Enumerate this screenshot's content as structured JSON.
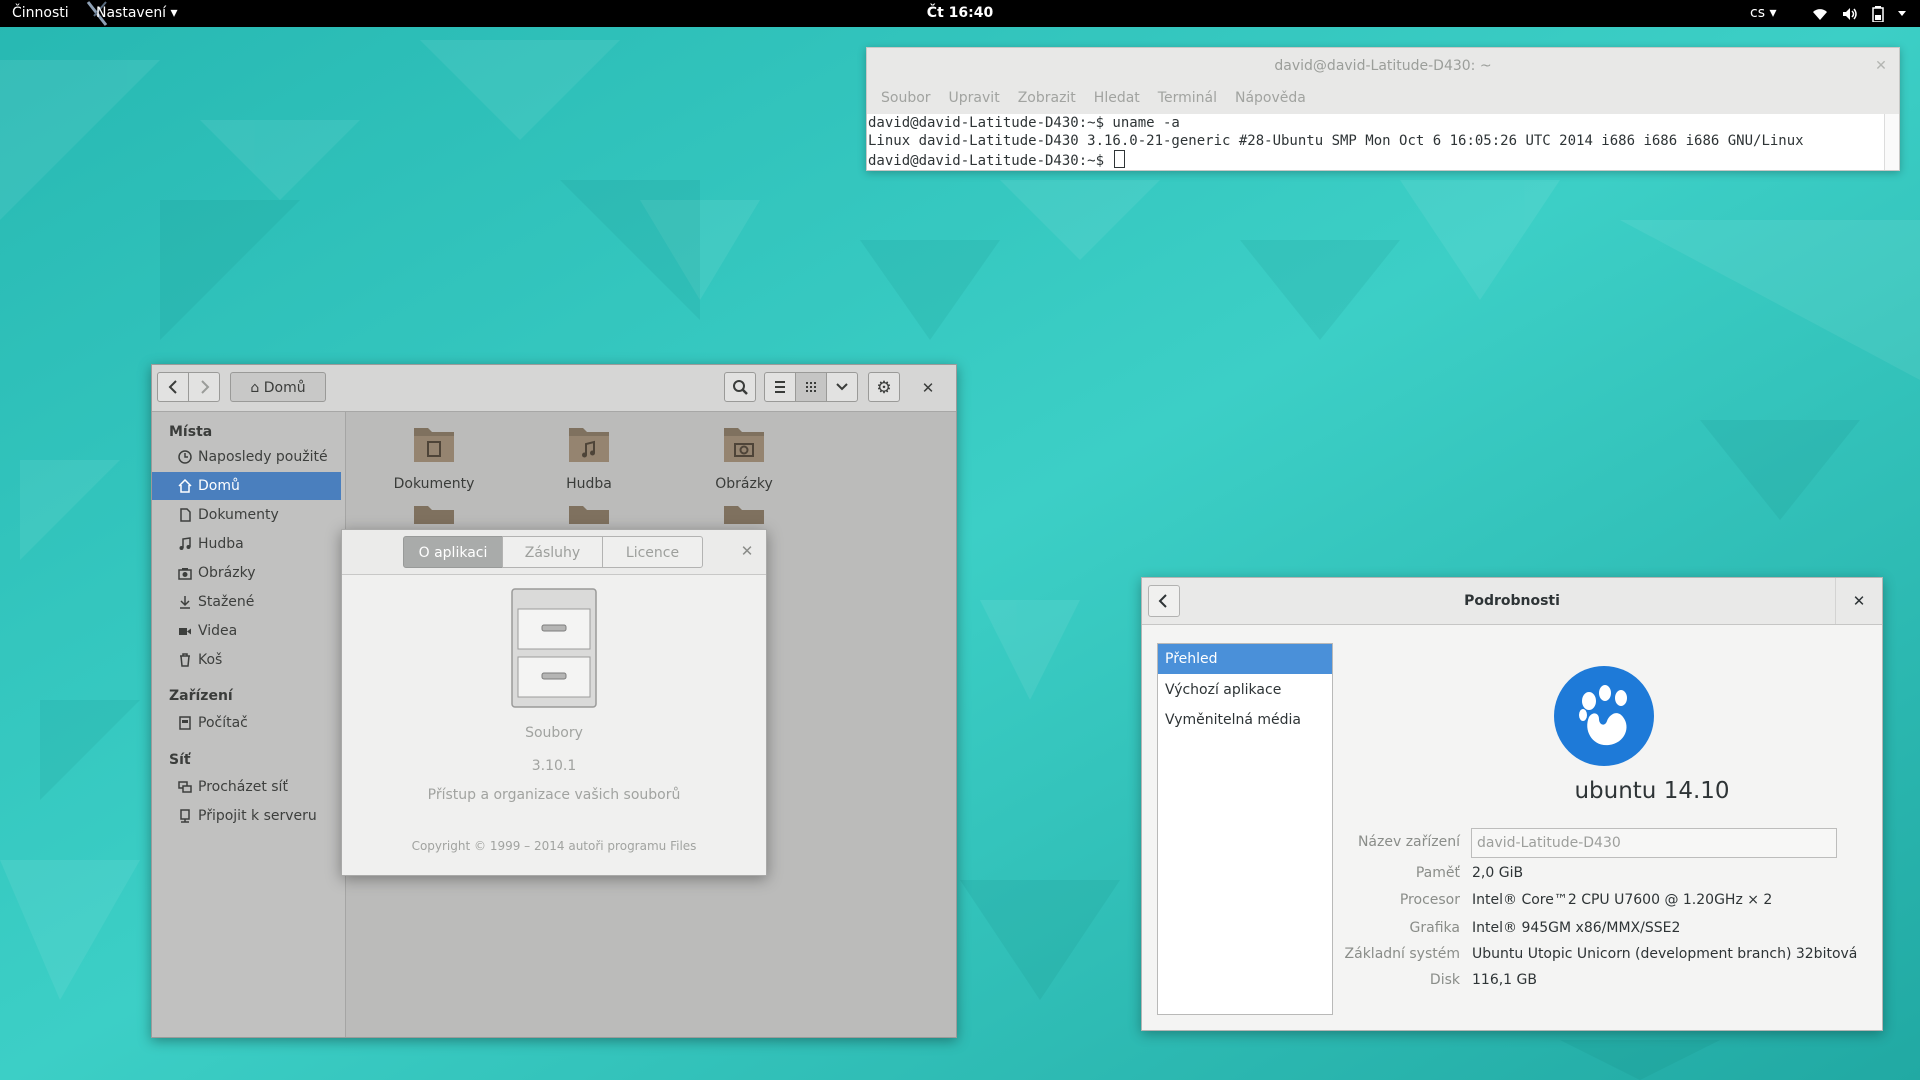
{
  "topbar": {
    "activities": "Činnosti",
    "app_menu": "Nastavení ▾",
    "clock": "Čt 16:40",
    "lang": "cs ▾"
  },
  "terminal": {
    "title": "david@david-Latitude-D430: ~",
    "menu": [
      "Soubor",
      "Upravit",
      "Zobrazit",
      "Hledat",
      "Terminál",
      "Nápověda"
    ],
    "lines": [
      "david@david-Latitude-D430:~$ uname -a",
      "Linux david-Latitude-D430 3.16.0-21-generic #28-Ubuntu SMP Mon Oct 6 16:05:26 UTC 2014 i686 i686 i686 GNU/Linux",
      "david@david-Latitude-D430:~$ "
    ]
  },
  "files": {
    "location": "Domů",
    "sidebar": {
      "places_heading": "Místa",
      "places": [
        "Naposledy použité",
        "Domů",
        "Dokumenty",
        "Hudba",
        "Obrázky",
        "Stažené",
        "Videa",
        "Koš"
      ],
      "devices_heading": "Zařízení",
      "devices": [
        "Počítač"
      ],
      "network_heading": "Síť",
      "network": [
        "Procházet síť",
        "Připojit k serveru"
      ]
    },
    "folders": [
      "Dokumenty",
      "Hudba",
      "Obrázky"
    ]
  },
  "about": {
    "tabs": [
      "O aplikaci",
      "Zásluhy",
      "Licence"
    ],
    "app_name": "Soubory",
    "version": "3.10.1",
    "description": "Přístup a organizace vašich souborů",
    "copyright": "Copyright © 1999 – 2014 autoři programu Files"
  },
  "details": {
    "title": "Podrobnosti",
    "nav": [
      "Přehled",
      "Výchozí aplikace",
      "Vyměnitelná média"
    ],
    "os_name": "ubuntu 14.10",
    "device_name_label": "Název zařízení",
    "device_name_value": "david-Latitude-D430",
    "memory_label": "Paměť",
    "memory_value": "2,0 GiB",
    "processor_label": "Procesor",
    "processor_value": "Intel® Core™2 CPU U7600 @ 1.20GHz × 2",
    "graphics_label": "Grafika",
    "graphics_value": "Intel® 945GM x86/MMX/SSE2",
    "system_label": "Základní systém",
    "system_value": "Ubuntu Utopic Unicorn (development branch) 32bitová",
    "disk_label": "Disk",
    "disk_value": "116,1 GB"
  },
  "colors": {
    "wallpaper": "#2bbdb5",
    "selection": "#4a90d9"
  }
}
